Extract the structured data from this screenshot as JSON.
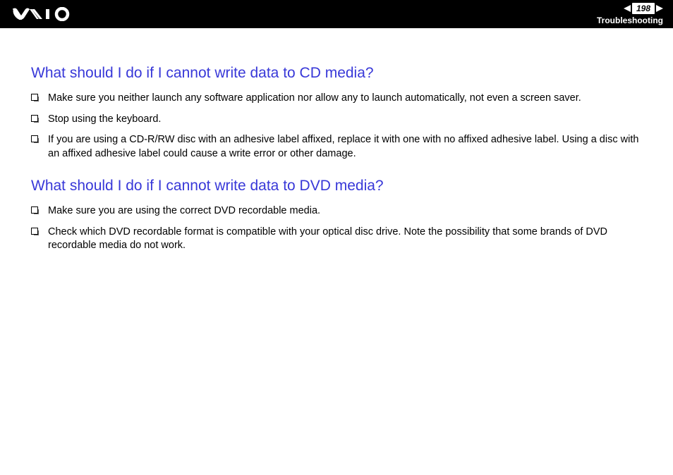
{
  "header": {
    "page_number": "198",
    "section": "Troubleshooting"
  },
  "sections": [
    {
      "heading": "What should I do if I cannot write data to CD media?",
      "items": [
        "Make sure you neither launch any software application nor allow any to launch automatically, not even a screen saver.",
        "Stop using the keyboard.",
        "If you are using a CD-R/RW disc with an adhesive label affixed, replace it with one with no affixed adhesive label. Using a disc with an affixed adhesive label could cause a write error or other damage."
      ]
    },
    {
      "heading": "What should I do if I cannot write data to DVD media?",
      "items": [
        "Make sure you are using the correct DVD recordable media.",
        "Check which DVD recordable format is compatible with your optical disc drive. Note the possibility that some brands of DVD recordable media do not work."
      ]
    }
  ]
}
